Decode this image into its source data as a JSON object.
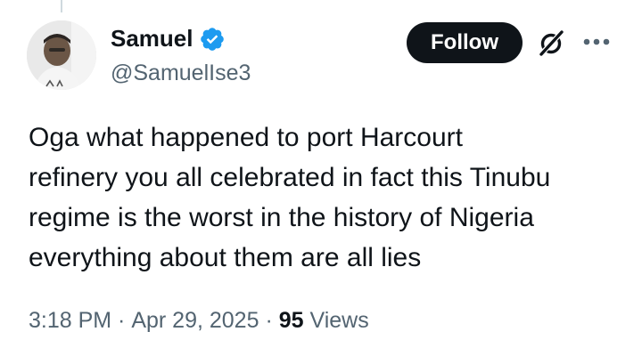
{
  "author": {
    "display_name": "Samuel",
    "handle": "@SamuelIse3",
    "verified": true,
    "avatar": "profile-photo"
  },
  "actions": {
    "follow_label": "Follow",
    "grok_icon": "grok-icon",
    "more_icon": "more-dots-icon"
  },
  "tweet": {
    "text": "Oga what happened to port Harcourt\nrefinery you all celebrated in fact this Tinubu\nregime is the worst in the history of Nigeria\neverything about them are all lies"
  },
  "meta": {
    "time": "3:18 PM",
    "separator": " · ",
    "date": "Apr 29, 2025",
    "views_count": "95",
    "views_label": " Views"
  },
  "colors": {
    "text": "#0f1419",
    "secondary": "#536471",
    "verified": "#1d9bf0",
    "button_bg": "#0f1419"
  }
}
